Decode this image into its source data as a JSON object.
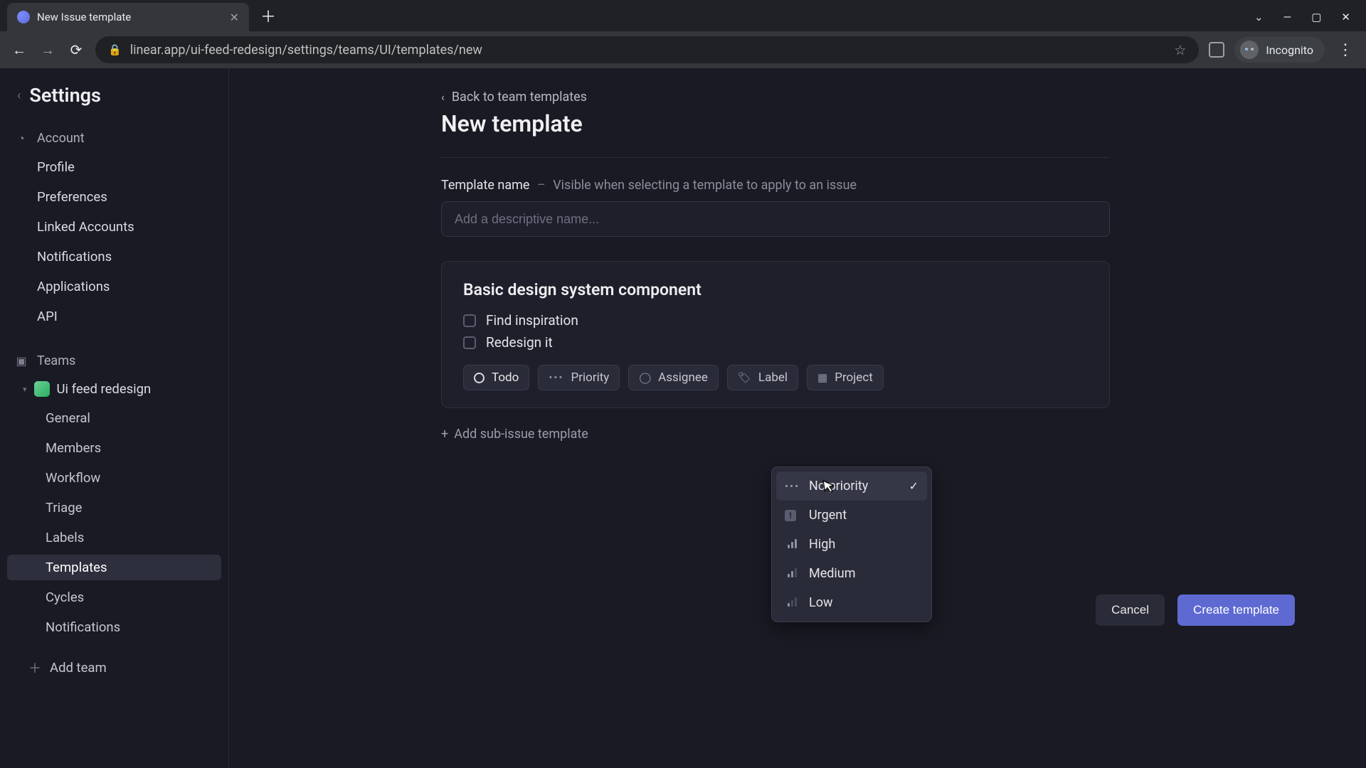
{
  "browser": {
    "tab_title": "New Issue template",
    "url": "linear.app/ui-feed-redesign/settings/teams/UI/templates/new",
    "incognito_label": "Incognito"
  },
  "sidebar": {
    "title": "Settings",
    "account_label": "Account",
    "account_items": [
      "Profile",
      "Preferences",
      "Linked Accounts",
      "Notifications",
      "Applications",
      "API"
    ],
    "teams_label": "Teams",
    "team_name": "Ui feed redesign",
    "team_items": [
      "General",
      "Members",
      "Workflow",
      "Triage",
      "Labels",
      "Templates",
      "Cycles",
      "Notifications"
    ],
    "team_active_index": 5,
    "add_team_label": "Add team"
  },
  "page": {
    "back_link": "Back to team templates",
    "title": "New template",
    "template_name_label": "Template name",
    "template_name_hint": "Visible when selecting a template to apply to an issue",
    "template_name_placeholder": "Add a descriptive name...",
    "issue_title": "Basic design system component",
    "checklist": [
      "Find inspiration",
      "Redesign it"
    ],
    "pills": {
      "status": "Todo",
      "priority": "Priority",
      "assignee": "Assignee",
      "label": "Label",
      "project": "Project"
    },
    "add_sub_issue": "Add sub-issue template",
    "cancel": "Cancel",
    "create": "Create template"
  },
  "priority_menu": {
    "items": [
      "No priority",
      "Urgent",
      "High",
      "Medium",
      "Low"
    ],
    "selected_index": 0
  }
}
